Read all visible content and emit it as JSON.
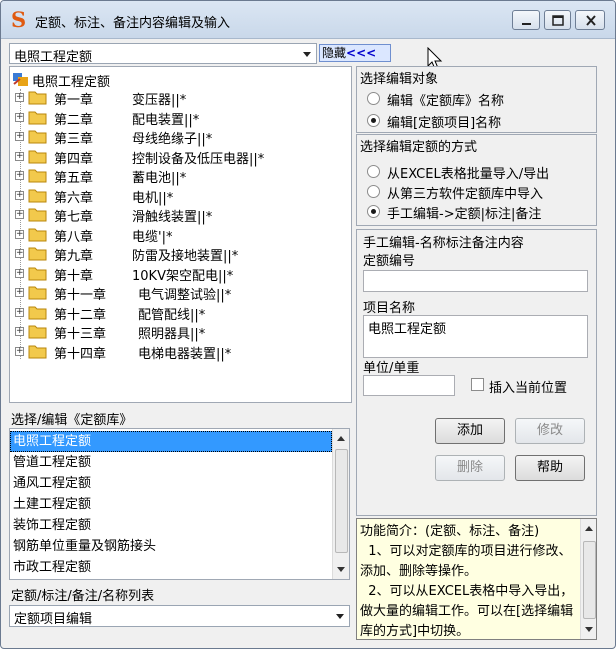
{
  "window": {
    "title": "定额、标注、备注内容编辑及输入",
    "controls": [
      "minimize",
      "maximize",
      "close"
    ]
  },
  "top": {
    "library_select_value": "电照工程定额",
    "hide_button_label": "隐藏",
    "hide_button_arrows": "<<<"
  },
  "tree": {
    "root_label": "电照工程定额",
    "chapters": [
      {
        "chapter": "第一章",
        "name": "变压器||*"
      },
      {
        "chapter": "第二章",
        "name": "配电装置||*"
      },
      {
        "chapter": "第三章",
        "name": "母线绝缘子||*"
      },
      {
        "chapter": "第四章",
        "name": "控制设备及低压电器||*"
      },
      {
        "chapter": "第五章",
        "name": "蓄电池||*"
      },
      {
        "chapter": "第六章",
        "name": "电机||*"
      },
      {
        "chapter": "第七章",
        "name": "滑触线装置||*"
      },
      {
        "chapter": "第八章",
        "name": "电缆'|*"
      },
      {
        "chapter": "第九章",
        "name": "防雷及接地装置||*"
      },
      {
        "chapter": "第十章",
        "name": "10KV架空配电||*"
      },
      {
        "chapter": "第十一章",
        "name": "电气调整试验||*"
      },
      {
        "chapter": "第十二章",
        "name": "配管配线||*"
      },
      {
        "chapter": "第十三章",
        "name": "照明器具||*"
      },
      {
        "chapter": "第十四章",
        "name": "电梯电器装置||*"
      }
    ]
  },
  "library_list": {
    "caption": "选择/编辑《定额库》",
    "selected_index": 0,
    "items": [
      "电照工程定额",
      "管道工程定额",
      "通风工程定额",
      "土建工程定额",
      "装饰工程定额",
      "钢筋单位重量及钢筋接头",
      "市政工程定额"
    ]
  },
  "bottom": {
    "caption": "定额/标注/备注/名称列表",
    "mode_select_value": "定额项目编辑"
  },
  "edit_target": {
    "caption": "选择编辑对象",
    "options": [
      "编辑《定额库》名称",
      "编辑[定额项目]名称"
    ],
    "selected_index": 1
  },
  "edit_method": {
    "caption": "选择编辑定额的方式",
    "options": [
      "从EXCEL表格批量导入/导出",
      "从第三方软件定额库中导入",
      "手工编辑->定额|标注|备注"
    ],
    "selected_index": 2
  },
  "manual": {
    "caption": "手工编辑-名称标注备注内容",
    "code_label": "定额编号",
    "code_value": "",
    "name_label": "项目名称",
    "name_value": "电照工程定额",
    "unit_label": "单位/单重",
    "unit_value": "",
    "insert_label": "插入当前位置",
    "insert_checked": false
  },
  "buttons": {
    "add": "添加",
    "modify": "修改",
    "delete": "删除",
    "help": "帮助"
  },
  "info": {
    "text": "功能简介：(定额、标注、备注)\n  1、可以对定额库的项目进行修改、添加、删除等操作。\n  2、可以从EXCEL表格中导入导出，做大量的编辑工作。可以在[选择编辑库的方式]中切换。"
  },
  "colors": {
    "selection": "#3399ff",
    "info_background": "#ffffe1",
    "folder": "#f2c94c",
    "app_icon": "#e05a10"
  }
}
